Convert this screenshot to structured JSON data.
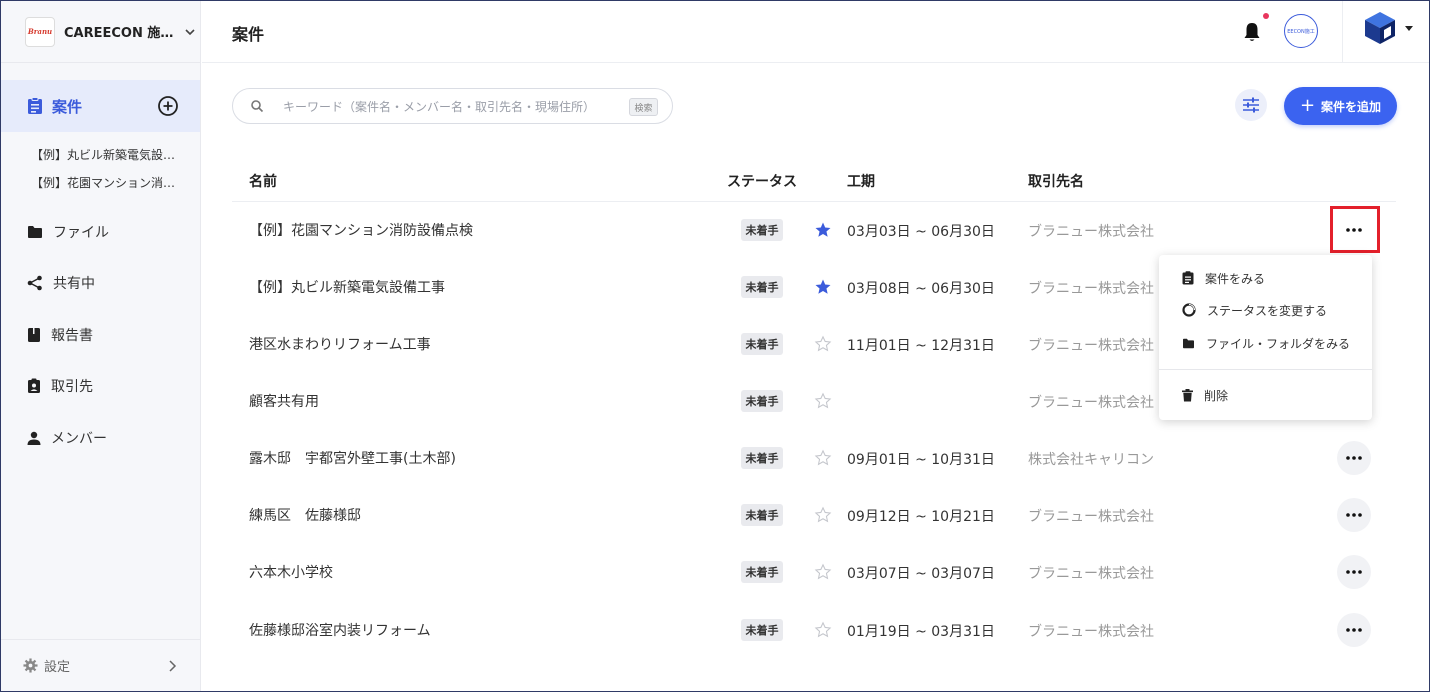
{
  "org": {
    "logo_text": "Branu",
    "name": "CAREECON 施…"
  },
  "sidebar": {
    "active": {
      "label": "案件"
    },
    "sub_items": [
      "【例】丸ビル新築電気設…",
      "【例】花園マンション消…"
    ],
    "items": [
      {
        "label": "ファイル",
        "icon": "folder-icon"
      },
      {
        "label": "共有中",
        "icon": "share-icon"
      },
      {
        "label": "報告書",
        "icon": "book-icon"
      },
      {
        "label": "取引先",
        "icon": "contact-badge-icon"
      },
      {
        "label": "メンバー",
        "icon": "person-icon"
      }
    ],
    "settings_label": "設定"
  },
  "header": {
    "title": "案件",
    "avatar_text": "EECON施工"
  },
  "toolbar": {
    "search_placeholder": "キーワード（案件名・メンバー名・取引先名・現場住所）",
    "search_kbd": "検索",
    "add_label": "案件を追加"
  },
  "table": {
    "columns": {
      "name": "名前",
      "status": "ステータス",
      "period": "工期",
      "client": "取引先名"
    },
    "rows": [
      {
        "name": "【例】花園マンション消防設備点検",
        "status": "未着手",
        "starred": true,
        "period": "03月03日 ~ 06月30日",
        "client": "ブラニュー株式会社"
      },
      {
        "name": "【例】丸ビル新築電気設備工事",
        "status": "未着手",
        "starred": true,
        "period": "03月08日 ~ 06月30日",
        "client": "ブラニュー株式会社"
      },
      {
        "name": "港区水まわりリフォーム工事",
        "status": "未着手",
        "starred": false,
        "period": "11月01日 ~ 12月31日",
        "client": "ブラニュー株式会社"
      },
      {
        "name": "顧客共有用",
        "status": "未着手",
        "starred": false,
        "period": "",
        "client": "ブラニュー株式会社"
      },
      {
        "name": "露木邸　宇都宮外壁工事(土木部)",
        "status": "未着手",
        "starred": false,
        "period": "09月01日 ~ 10月31日",
        "client": "株式会社キャリコン"
      },
      {
        "name": "練馬区　佐藤様邸",
        "status": "未着手",
        "starred": false,
        "period": "09月12日 ~ 10月21日",
        "client": "ブラニュー株式会社"
      },
      {
        "name": "六本木小学校",
        "status": "未着手",
        "starred": false,
        "period": "03月07日 ~ 03月07日",
        "client": "ブラニュー株式会社"
      },
      {
        "name": "佐藤様邸浴室内装リフォーム",
        "status": "未着手",
        "starred": false,
        "period": "01月19日 ~ 03月31日",
        "client": "ブラニュー株式会社"
      }
    ]
  },
  "context_menu": {
    "items": [
      {
        "label": "案件をみる",
        "icon": "clipboard-icon"
      },
      {
        "label": "ステータスを変更する",
        "icon": "status-ring-icon"
      },
      {
        "label": "ファイル・フォルダをみる",
        "icon": "folder-icon"
      }
    ],
    "delete_label": "削除"
  },
  "colors": {
    "accent": "#3b63f0",
    "active_bg": "#e6ebfb",
    "star": "#3b5bdb",
    "highlight": "#e3202b"
  }
}
